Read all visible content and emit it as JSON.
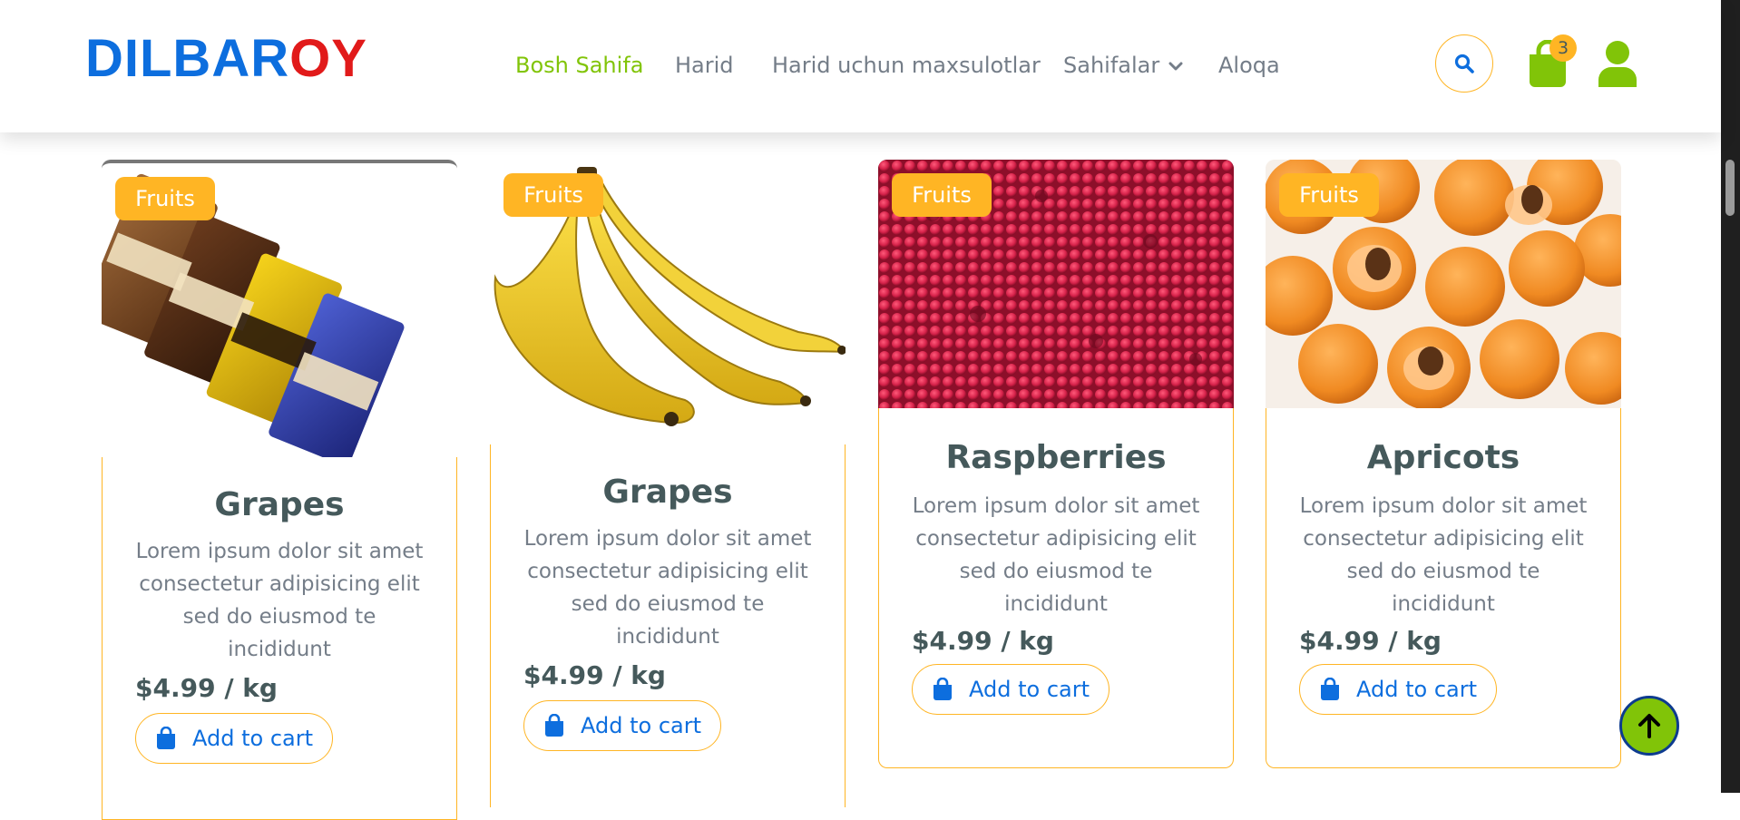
{
  "brand": {
    "part1": "DILBAR",
    "part2": "OY"
  },
  "nav": {
    "links": [
      {
        "label": "Bosh Sahifa",
        "active": true
      },
      {
        "label": "Harid",
        "active": false
      },
      {
        "label": "Harid uchun maxsulotlar",
        "active": false
      },
      {
        "label": "Sahifalar",
        "active": false,
        "dropdown": true
      },
      {
        "label": "Aloqa",
        "active": false
      }
    ],
    "cart_count": "3",
    "icons": [
      "search-icon",
      "shopping-bag-icon",
      "user-icon"
    ]
  },
  "products": [
    {
      "category": "Fruits",
      "title": "Grapes",
      "description": "Lorem ipsum dolor sit amet consectetur adipisicing elit sed do eiusmod te incididunt",
      "price": "$4.99 / kg",
      "button": "Add to cart",
      "image": "ice-cream-bars-image"
    },
    {
      "category": "Fruits",
      "title": "Grapes",
      "description": "Lorem ipsum dolor sit amet consectetur adipisicing elit sed do eiusmod te incididunt",
      "price": "$4.99 / kg",
      "button": "Add to cart",
      "image": "bananas-image"
    },
    {
      "category": "Fruits",
      "title": "Raspberries",
      "description": "Lorem ipsum dolor sit amet consectetur adipisicing elit sed do eiusmod te incididunt",
      "price": "$4.99 / kg",
      "button": "Add to cart",
      "image": "raspberries-image"
    },
    {
      "category": "Fruits",
      "title": "Apricots",
      "description": "Lorem ipsum dolor sit amet consectetur adipisicing elit sed do eiusmod te incididunt",
      "price": "$4.99 / kg",
      "button": "Add to cart",
      "image": "apricots-image"
    }
  ],
  "colors": {
    "primary_green": "#81c408",
    "accent_orange": "#ffb524",
    "logo_blue": "#0d6ede",
    "logo_red": "#e11a1a",
    "heading": "#45595b",
    "text": "#747d88"
  }
}
